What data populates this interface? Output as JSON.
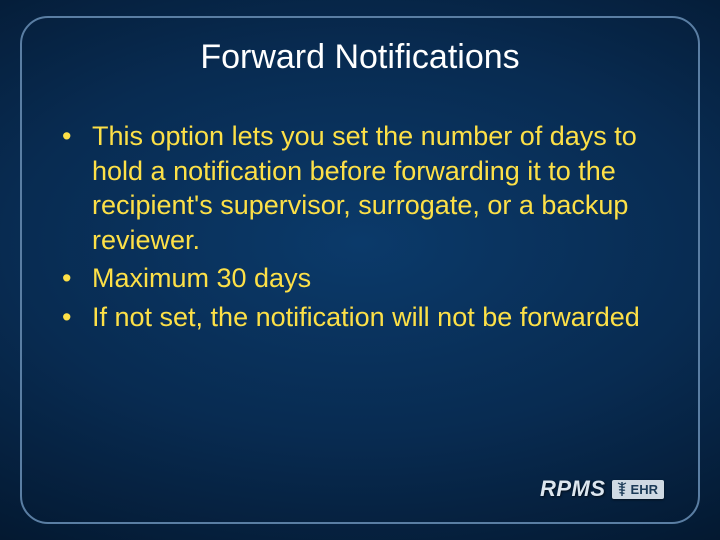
{
  "slide": {
    "title": "Forward Notifications",
    "bullets": [
      "This option lets you set the number of days to hold a notification before forwarding it to the recipient's supervisor, surrogate, or a backup reviewer.",
      "Maximum 30 days",
      "If not set, the notification will not be forwarded"
    ],
    "logo": {
      "rpms": "RPMS",
      "ehr": "EHR"
    }
  }
}
